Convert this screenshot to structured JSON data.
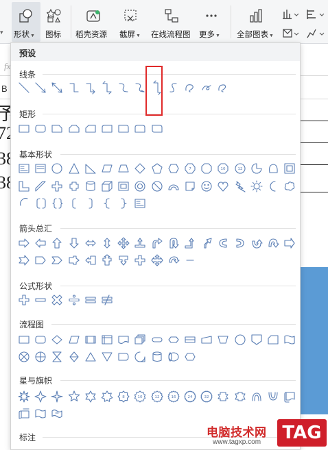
{
  "ribbon": {
    "buttons": [
      {
        "label": "形状",
        "icon": "shapes-icon",
        "dropdown": true
      },
      {
        "label": "图标",
        "icon": "icons-icon",
        "dropdown": false
      },
      {
        "label": "稻壳资源",
        "icon": "docer-resources-icon",
        "dropdown": false
      },
      {
        "label": "截屏",
        "icon": "screenshot-icon",
        "dropdown": true
      },
      {
        "label": "在线流程图",
        "icon": "online-flowchart-icon",
        "dropdown": false
      },
      {
        "label": "更多",
        "icon": "more-icon",
        "dropdown": true
      },
      {
        "label": "全部图表",
        "icon": "all-charts-icon",
        "dropdown": true
      }
    ]
  },
  "sheet": {
    "column_header": "B",
    "fx": "fx",
    "cell_digits": [
      "予",
      "72",
      "38",
      "38"
    ]
  },
  "panel": {
    "title": "预设",
    "sections": [
      {
        "title": "线条",
        "count": 13
      },
      {
        "title": "矩形",
        "count": 9
      },
      {
        "title": "基本形状",
        "count": 42
      },
      {
        "title": "箭头总汇",
        "count": 28
      },
      {
        "title": "公式形状",
        "count": 6
      },
      {
        "title": "流程图",
        "count": 28
      },
      {
        "title": "星与旗帜",
        "count": 20
      },
      {
        "title": "标注",
        "count": 0
      }
    ],
    "highlighted": "elbow-double-arrow-connector"
  },
  "watermark": {
    "text": "电脑技术网",
    "url": "www.tagxp.com",
    "badge": "TAG"
  },
  "colors": {
    "shape_stroke": "#5b7fb5",
    "highlight": "#e02a2a",
    "chart_bar": "#5b9bd5",
    "panel_header": "#f2f3f5"
  }
}
